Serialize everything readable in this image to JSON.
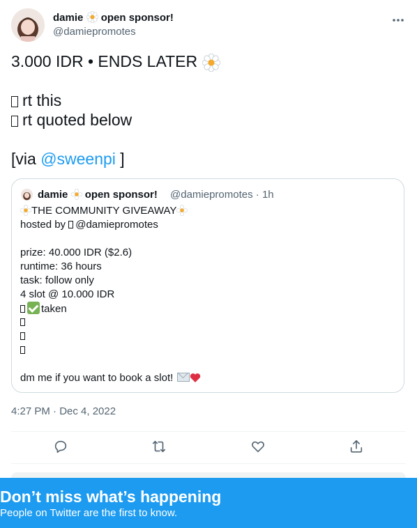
{
  "tweet": {
    "author_name": "damie",
    "author_suffix": "open sponsor!",
    "handle": "@damiepromotes",
    "lines": {
      "l1": "3.000 IDR • ENDS LATER",
      "l2": "rt this",
      "l3": "rt quoted below",
      "l4_prefix": "[via ",
      "l4_mention": "@sweenpi",
      "l4_suffix": " ]"
    },
    "timestamp": "4:27 PM · Dec 4, 2022"
  },
  "quote": {
    "author_name": "damie",
    "author_suffix": "open sponsor!",
    "meta": "@damiepromotes · 1h",
    "title": "THE COMMUNITY GIVEAWAY",
    "hosted_prefix": "hosted by",
    "hosted_handle": "@damiepromotes",
    "prize": "prize: 40.000 IDR ($2.6)",
    "runtime": "runtime: 36 hours",
    "task": "task: follow only",
    "slots": "4 slot @ 10.000 IDR",
    "slot1_status": "taken",
    "dm": "dm me if you want to book a slot!"
  },
  "banner": {
    "title": "Don’t miss what’s happening",
    "subtitle": "People on Twitter are the first to know."
  },
  "icons": {
    "reply": "reply-icon",
    "retweet": "retweet-icon",
    "like": "like-icon",
    "share": "share-icon",
    "more": "more-icon"
  },
  "colors": {
    "accent": "#1d9bf0",
    "text": "#0f1419",
    "secondary": "#536471",
    "border": "#cfd9de"
  }
}
